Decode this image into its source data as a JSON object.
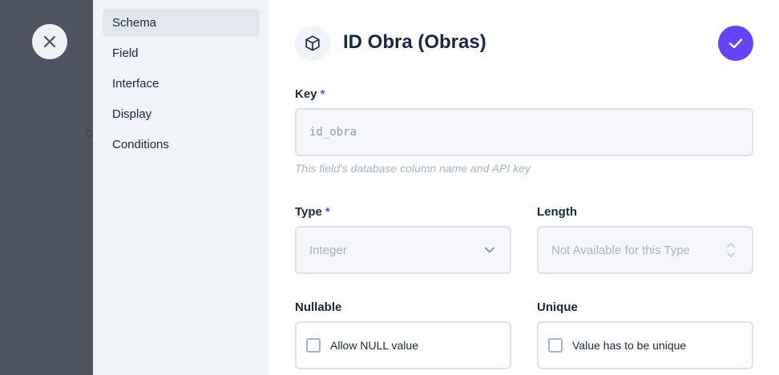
{
  "nav": {
    "items": [
      {
        "label": "Schema",
        "active": true
      },
      {
        "label": "Field",
        "active": false
      },
      {
        "label": "Interface",
        "active": false
      },
      {
        "label": "Display",
        "active": false
      },
      {
        "label": "Conditions",
        "active": false
      }
    ]
  },
  "header": {
    "title": "ID Obra (Obras)",
    "icon": "box-icon",
    "save_icon": "check-icon",
    "close_icon": "close-icon"
  },
  "form": {
    "key": {
      "label": "Key",
      "required_mark": "*",
      "value": "id_obra",
      "hint": "This field's database column name and API key"
    },
    "type": {
      "label": "Type",
      "required_mark": "*",
      "value": "Integer"
    },
    "length": {
      "label": "Length",
      "placeholder": "Not Available for this Type"
    },
    "nullable": {
      "label": "Nullable",
      "option": "Allow NULL value",
      "checked": false
    },
    "unique": {
      "label": "Unique",
      "option": "Value has to be unique",
      "checked": false
    }
  },
  "colors": {
    "accent": "#6644ff",
    "overlay": "#4f5560",
    "nav_bg": "#f0f4f9",
    "text": "#172940",
    "muted": "#a2b5cd"
  }
}
